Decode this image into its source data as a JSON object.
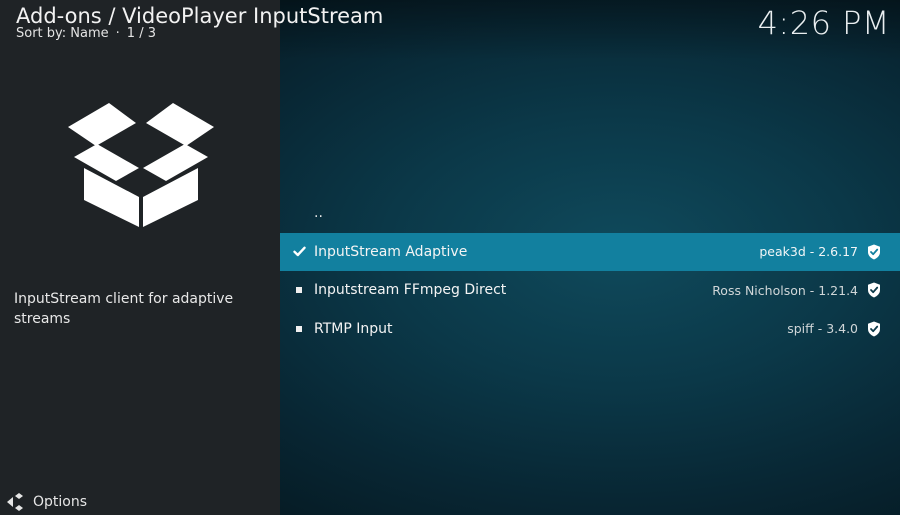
{
  "header": {
    "title": "Add-ons / VideoPlayer InputStream",
    "sort_label": "Sort by: Name",
    "separator": "·",
    "position": "1 / 3"
  },
  "clock": "4:26 PM",
  "selected_addon": {
    "icon": "open-box-icon",
    "description": "InputStream client for adaptive streams"
  },
  "list": {
    "parent_label": "..",
    "items": [
      {
        "name": "InputStream Adaptive",
        "meta": "peak3d - 2.6.17",
        "marker": "check-icon",
        "focused": true
      },
      {
        "name": "Inputstream FFmpeg Direct",
        "meta": "Ross Nicholson - 1.21.4",
        "marker": "bullet",
        "focused": false
      },
      {
        "name": "RTMP Input",
        "meta": "spiff - 3.4.0",
        "marker": "bullet",
        "focused": false
      }
    ]
  },
  "footer": {
    "options_label": "Options"
  },
  "colors": {
    "focus_highlight": "#12809f",
    "left_panel": "#1f2326",
    "background_center": "#0f4a5c"
  }
}
